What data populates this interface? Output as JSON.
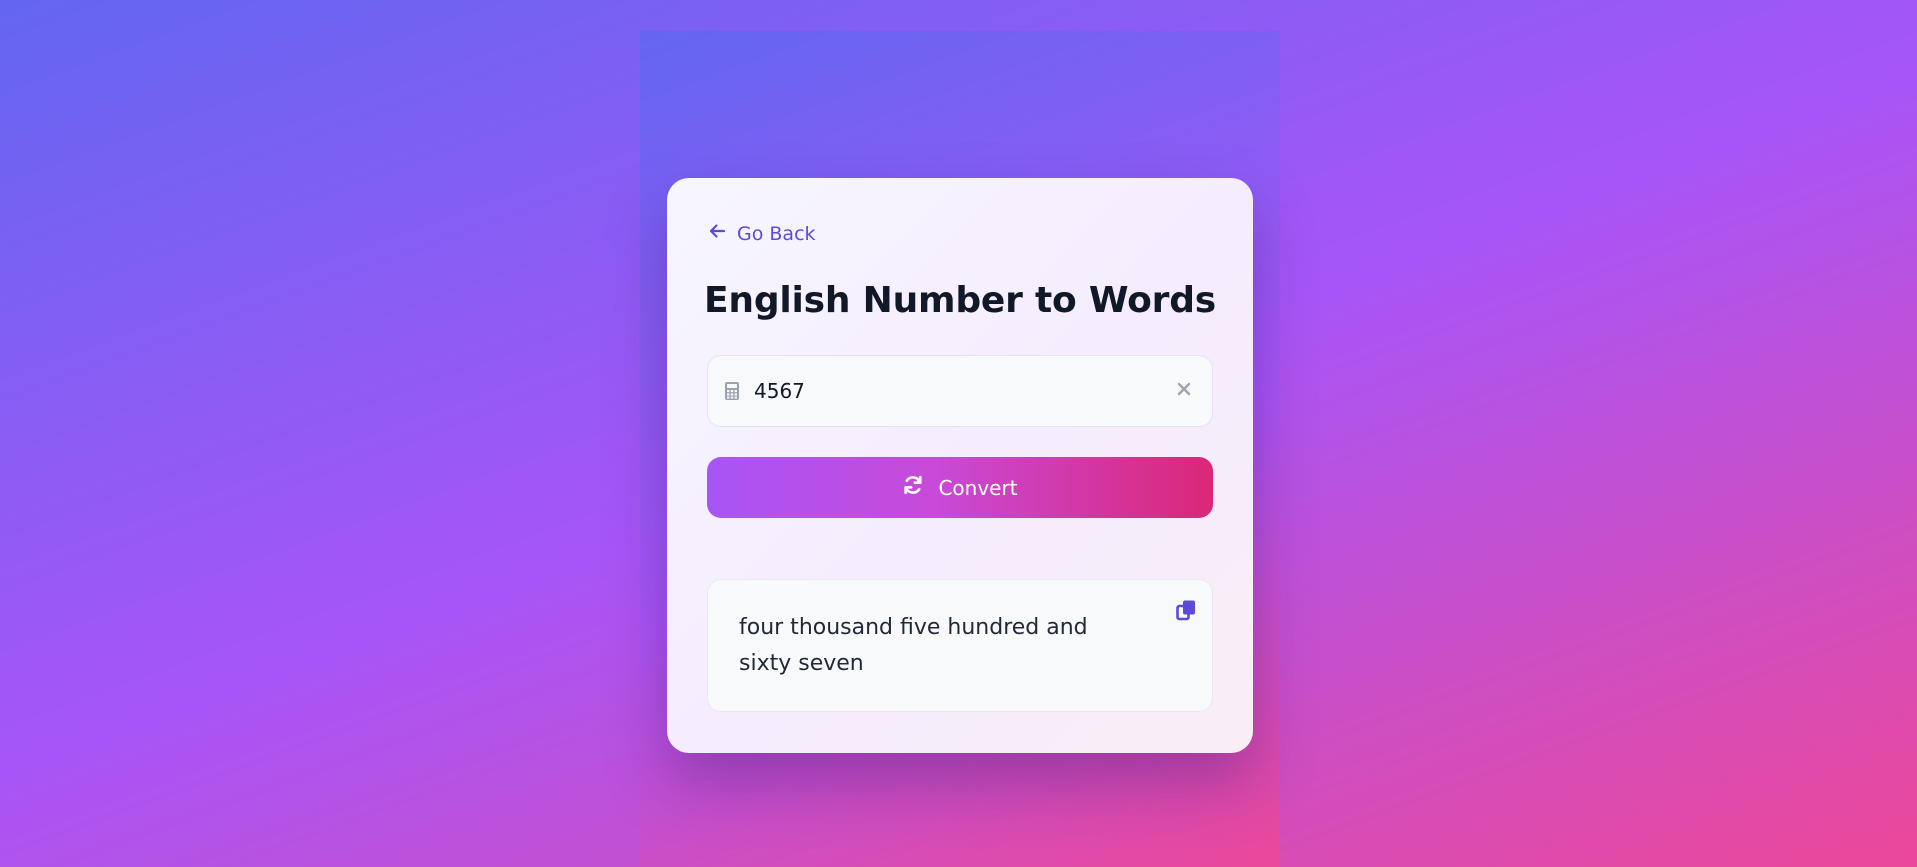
{
  "nav": {
    "back_label": "Go Back"
  },
  "header": {
    "title": "English Number to Words"
  },
  "input": {
    "value": "4567",
    "placeholder": ""
  },
  "actions": {
    "convert_label": "Convert"
  },
  "result": {
    "text": "four thousand five hundred and sixty seven"
  },
  "icons": {
    "back": "arrow-left-icon",
    "input": "calculator-icon",
    "clear": "close-icon",
    "convert": "refresh-icon",
    "copy": "copy-icon"
  },
  "colors": {
    "accent": "#5b4bd6",
    "button_start": "#a855f7",
    "button_end": "#db2777",
    "title": "#111827"
  }
}
